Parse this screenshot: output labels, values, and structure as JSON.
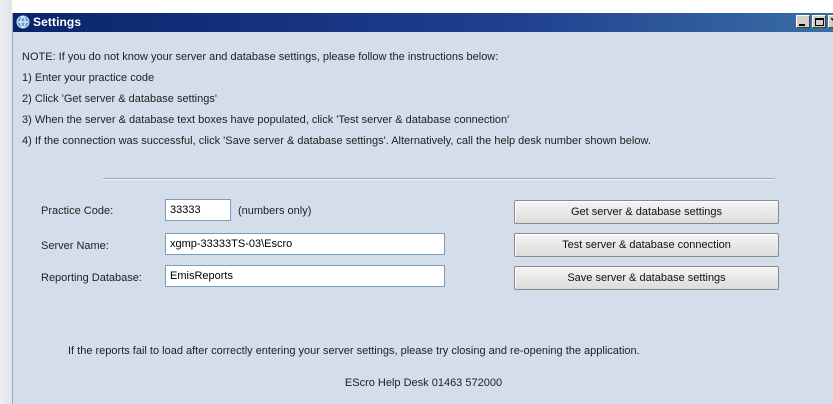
{
  "window": {
    "title": "Settings"
  },
  "notes": [
    "NOTE: If you do not know your server and database settings, please follow the instructions below:",
    "1) Enter your practice code",
    "2) Click 'Get server & database settings'",
    "3) When the server & database text boxes have populated, click 'Test server & database connection'",
    "4) If the connection was successful, click 'Save server & database settings'. Alternatively, call the help desk number shown below."
  ],
  "form": {
    "practice_code_label": "Practice Code:",
    "practice_code_value": "33333",
    "practice_code_hint": "(numbers only)",
    "server_name_label": "Server Name:",
    "server_name_value": "xgmp-33333TS-03\\Escro",
    "reporting_db_label": "Reporting Database:",
    "reporting_db_value": "EmisReports"
  },
  "buttons": {
    "get_settings": "Get server & database settings",
    "test_connection": "Test server & database connection",
    "save_settings": "Save server & database settings"
  },
  "footer": {
    "fail_message": "If the reports fail to load after correctly entering your server settings, please try closing and re-opening the application.",
    "help_desk": "EScro Help Desk 01463 572000"
  },
  "colors": {
    "titlebar": "#0a246a",
    "window_bg": "#d3deea"
  }
}
